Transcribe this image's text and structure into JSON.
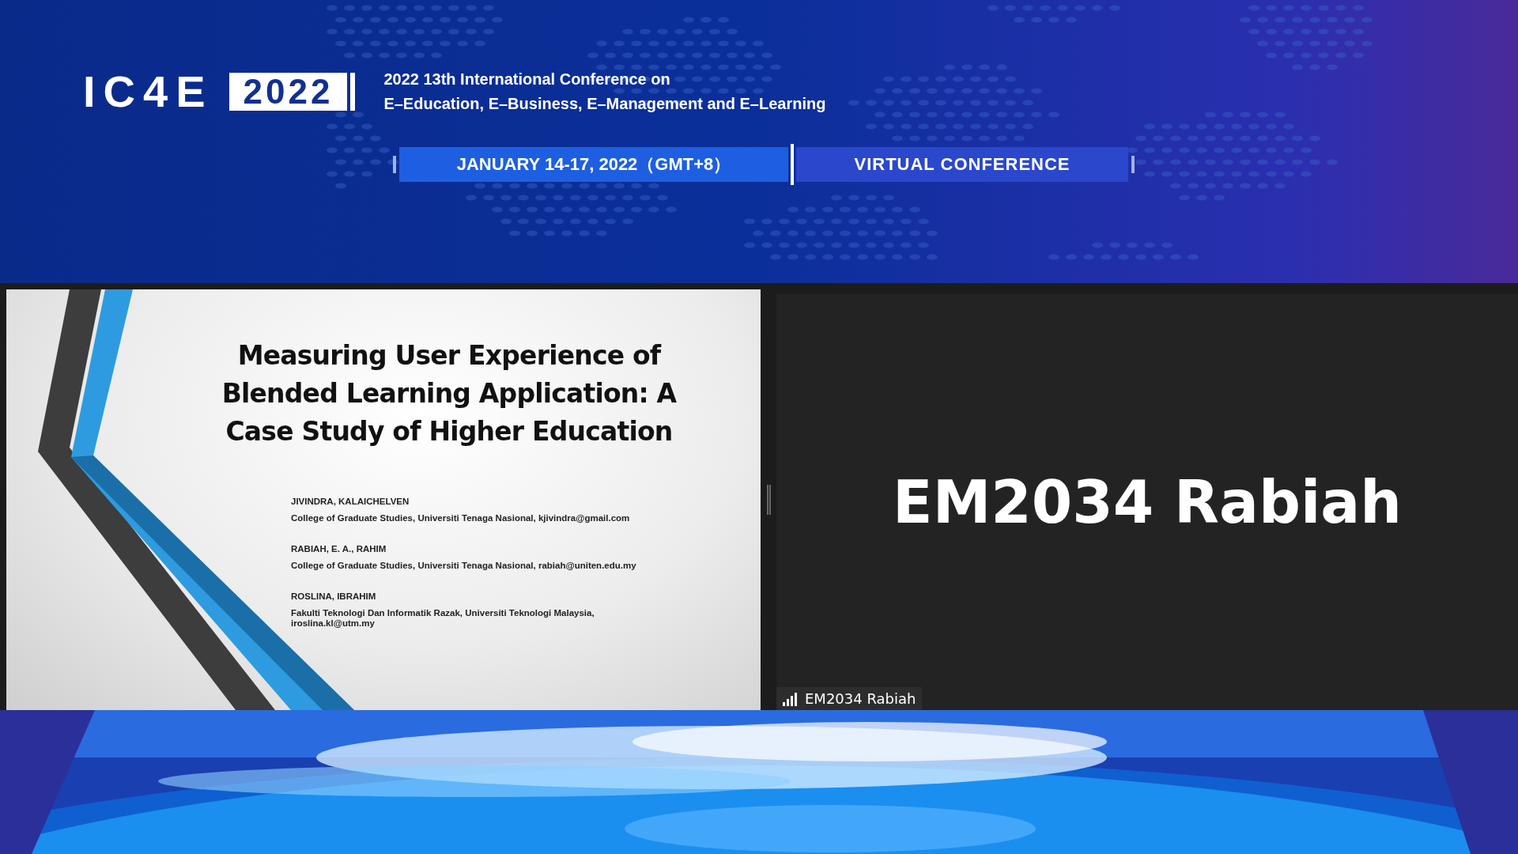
{
  "header": {
    "logo": {
      "acronym": "IC4E",
      "year": "2022"
    },
    "conference_title": [
      "2022 13th International Conference on",
      "E–Education, E–Business, E–Management and E–Learning"
    ],
    "date": "JANUARY 14-17, 2022（GMT+8）",
    "format": "VIRTUAL CONFERENCE"
  },
  "slide": {
    "title": "Measuring User Experience of Blended Learning Application: A Case Study of Higher Education",
    "authors": [
      {
        "name": "JIVINDRA, KALAICHELVEN",
        "affiliation": "College of Graduate Studies, Universiti Tenaga Nasional, kjivindra@gmail.com"
      },
      {
        "name": "RABIAH, E. A., RAHIM",
        "affiliation": "College of Graduate Studies, Universiti Tenaga Nasional, rabiah@uniten.edu.my"
      },
      {
        "name": "ROSLINA, IBRAHIM",
        "affiliation": "Fakulti Teknologi Dan Informatik Razak, Universiti Teknologi Malaysia, iroslina.kl@utm.my"
      }
    ]
  },
  "participant": {
    "display_name": "EM2034 Rabiah",
    "name_label": "EM2034 Rabiah"
  }
}
